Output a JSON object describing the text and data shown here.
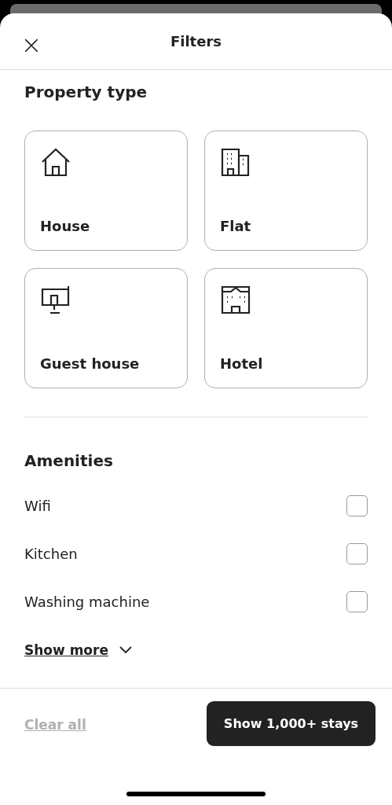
{
  "header": {
    "close": "×",
    "title": "Filters"
  },
  "property_type": {
    "title": "Property type",
    "options": [
      {
        "label": "House",
        "kind": "house",
        "selected": false
      },
      {
        "label": "Flat",
        "kind": "flat",
        "selected": false
      },
      {
        "label": "Guest house",
        "kind": "guesthouse",
        "selected": false
      },
      {
        "label": "Hotel",
        "kind": "hotel",
        "selected": false
      }
    ]
  },
  "amenities": {
    "title": "Amenities",
    "items": [
      {
        "label": "Wifi",
        "checked": false
      },
      {
        "label": "Kitchen",
        "checked": false
      },
      {
        "label": "Washing machine",
        "checked": false
      }
    ],
    "show_more": "Show more"
  },
  "footer": {
    "clear": {
      "label": "Clear all",
      "disabled": true
    },
    "submit": "Show 1,000+ stays"
  }
}
